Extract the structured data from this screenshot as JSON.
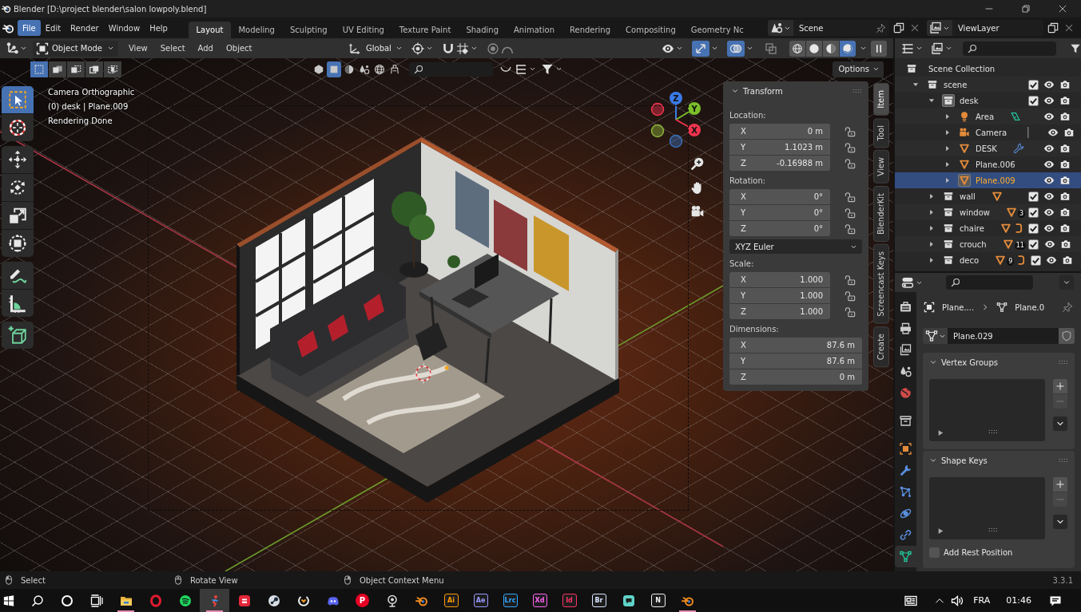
{
  "window": {
    "title": "Blender [D:\\project blender\\salon lowpoly.blend]"
  },
  "top_bar": {
    "menus": [
      {
        "label": "File",
        "selected": true
      },
      {
        "label": "Edit",
        "selected": false
      },
      {
        "label": "Render",
        "selected": false
      },
      {
        "label": "Window",
        "selected": false
      },
      {
        "label": "Help",
        "selected": false
      }
    ],
    "workspaces": [
      {
        "label": "Layout",
        "selected": true
      },
      {
        "label": "Modeling",
        "selected": false
      },
      {
        "label": "Sculpting",
        "selected": false
      },
      {
        "label": "UV Editing",
        "selected": false
      },
      {
        "label": "Texture Paint",
        "selected": false
      },
      {
        "label": "Shading",
        "selected": false
      },
      {
        "label": "Animation",
        "selected": false
      },
      {
        "label": "Rendering",
        "selected": false
      },
      {
        "label": "Compositing",
        "selected": false
      },
      {
        "label": "Geometry Nc",
        "selected": false
      }
    ],
    "scene": "Scene",
    "view_layer": "ViewLayer"
  },
  "viewport_header": {
    "mode": "Object Mode",
    "menus": [
      "View",
      "Select",
      "Add",
      "Object"
    ],
    "orientation": "Global",
    "toggles": [
      {
        "kind": "gizmo",
        "on": true
      },
      {
        "kind": "overlay",
        "on": true
      },
      {
        "kind": "xray",
        "on": false
      }
    ],
    "shading_modes": [
      {
        "kind": "wireframe",
        "selected": false
      },
      {
        "kind": "solid",
        "selected": false
      },
      {
        "kind": "material",
        "selected": false
      },
      {
        "kind": "rendered",
        "selected": true
      }
    ]
  },
  "tool_header": {
    "select_modes": [
      {
        "kind": "set",
        "selected": true
      },
      {
        "kind": "extend",
        "selected": false
      },
      {
        "kind": "subtract",
        "selected": false
      },
      {
        "kind": "invert",
        "selected": false
      },
      {
        "kind": "intersect",
        "selected": false
      }
    ],
    "object_types": [
      {
        "kind": "hexagon",
        "selected": false
      },
      {
        "kind": "square",
        "selected": true
      },
      {
        "kind": "half-circle",
        "selected": false
      },
      {
        "kind": "drops",
        "selected": false
      },
      {
        "kind": "globe",
        "selected": false
      },
      {
        "kind": "stool",
        "selected": false
      }
    ],
    "options": "Options"
  },
  "viewport": {
    "overlay_text": [
      "Camera Orthographic",
      "(0) desk | Plane.009",
      "Rendering Done"
    ],
    "tool_groups": [
      {
        "tools": [
          {
            "kind": "select-box",
            "selected": true
          },
          {
            "kind": "cursor",
            "selected": false
          }
        ]
      },
      {
        "tools": [
          {
            "kind": "move",
            "selected": false
          },
          {
            "kind": "rotate",
            "selected": false
          },
          {
            "kind": "scale",
            "selected": false
          },
          {
            "kind": "transform",
            "selected": false
          }
        ]
      },
      {
        "tools": [
          {
            "kind": "annotate",
            "selected": false
          },
          {
            "kind": "measure",
            "selected": false
          }
        ]
      },
      {
        "tools": [
          {
            "kind": "add-cube",
            "selected": false
          }
        ]
      }
    ],
    "gizmo": {
      "axes": [
        {
          "kind": "positive",
          "label": "Z",
          "color": "#3a7be8"
        },
        {
          "kind": "positive",
          "label": "Y",
          "color": "#7bbf2a"
        },
        {
          "kind": "positive",
          "label": "X",
          "color": "#f0344e"
        },
        {
          "kind": "negative",
          "color": "#f0344e"
        },
        {
          "kind": "negative",
          "color": "#8db33a"
        },
        {
          "kind": "negative",
          "color": "#3a6fb8"
        }
      ]
    }
  },
  "sidebar": {
    "panel": {
      "title": "Transform",
      "expanded": true,
      "groups": [
        {
          "kind": "vector",
          "label": "Location:",
          "rows": [
            {
              "axis": "X",
              "value": "0 m",
              "locked": false
            },
            {
              "axis": "Y",
              "value": "1.1023 m",
              "locked": false
            },
            {
              "axis": "Z",
              "value": "-0.16988 m",
              "locked": false
            }
          ]
        },
        {
          "kind": "vector",
          "label": "Rotation:",
          "rows": [
            {
              "axis": "X",
              "value": "0°",
              "locked": false
            },
            {
              "axis": "Y",
              "value": "0°",
              "locked": false
            },
            {
              "axis": "Z",
              "value": "0°",
              "locked": false
            }
          ]
        },
        {
          "kind": "dropdown",
          "value": "XYZ Euler"
        },
        {
          "kind": "vector",
          "label": "Scale:",
          "rows": [
            {
              "axis": "X",
              "value": "1.000",
              "locked": false
            },
            {
              "axis": "Y",
              "value": "1.000",
              "locked": false
            },
            {
              "axis": "Z",
              "value": "1.000",
              "locked": false
            }
          ]
        },
        {
          "kind": "vector",
          "label": "Dimensions:",
          "rows": [
            {
              "axis": "X",
              "value": "87.6 m"
            },
            {
              "axis": "Y",
              "value": "87.6 m"
            },
            {
              "axis": "Z",
              "value": "0 m"
            }
          ]
        }
      ]
    },
    "tabs": [
      {
        "label": "Item",
        "selected": true
      },
      {
        "label": "Tool",
        "selected": false
      },
      {
        "label": "View",
        "selected": false
      },
      {
        "label": "BlenderKit",
        "selected": false
      },
      {
        "label": "Screencast Keys",
        "selected": false
      },
      {
        "label": "Create",
        "selected": false
      }
    ]
  },
  "outliner": {
    "root": "Scene Collection",
    "items": [
      {
        "name": "scene",
        "kind": "collection",
        "expanded": true,
        "selected": false,
        "active": false,
        "checked": true,
        "children": [
          {
            "name": "desk",
            "kind": "collection",
            "expanded": true,
            "selected": false,
            "active": true,
            "checked": true,
            "children": [
              {
                "name": "Area",
                "kind": "light",
                "expanded": false,
                "selected": false,
                "active": false,
                "extras": [
                  {
                    "kind": "light-data"
                  }
                ]
              },
              {
                "name": "Camera",
                "kind": "camera",
                "expanded": false,
                "selected": false,
                "active": false,
                "extras": [
                  {
                    "kind": "camera-data"
                  }
                ]
              },
              {
                "name": "DESK",
                "kind": "mesh",
                "expanded": false,
                "selected": false,
                "active": false,
                "extras": [
                  {
                    "kind": "modifier"
                  }
                ]
              },
              {
                "name": "Plane.006",
                "kind": "mesh",
                "expanded": false,
                "selected": false,
                "active": false
              },
              {
                "name": "Plane.009",
                "kind": "mesh",
                "expanded": false,
                "selected": true,
                "active": true
              }
            ]
          },
          {
            "name": "wall",
            "kind": "collection",
            "expanded": false,
            "selected": false,
            "active": false,
            "checked": true,
            "extras": [
              {
                "kind": "mesh"
              }
            ]
          },
          {
            "name": "window",
            "kind": "collection",
            "expanded": false,
            "selected": false,
            "active": false,
            "checked": true,
            "extras": [
              {
                "kind": "mesh",
                "count": "3"
              }
            ]
          },
          {
            "name": "chaire",
            "kind": "collection",
            "expanded": false,
            "selected": false,
            "active": false,
            "checked": true,
            "extras": [
              {
                "kind": "mesh"
              },
              {
                "kind": "clipped"
              }
            ]
          },
          {
            "name": "crouch",
            "kind": "collection",
            "expanded": false,
            "selected": false,
            "active": false,
            "checked": true,
            "extras": [
              {
                "kind": "mesh",
                "count": "11"
              }
            ]
          },
          {
            "name": "deco",
            "kind": "collection",
            "expanded": false,
            "selected": false,
            "active": false,
            "checked": true,
            "extras": [
              {
                "kind": "mesh",
                "count": "9"
              },
              {
                "kind": "clipped"
              }
            ]
          }
        ]
      }
    ]
  },
  "properties": {
    "tab_groups": [
      {
        "tabs": [
          {
            "kind": "tool",
            "selected": false
          },
          {
            "kind": "output",
            "selected": false
          },
          {
            "kind": "view-layer",
            "selected": false
          },
          {
            "kind": "scene",
            "selected": false
          },
          {
            "kind": "world",
            "selected": false
          }
        ]
      },
      {
        "tabs": [
          {
            "kind": "collection",
            "selected": false
          }
        ]
      },
      {
        "tabs": [
          {
            "kind": "object",
            "selected": false
          },
          {
            "kind": "modifiers",
            "selected": false
          },
          {
            "kind": "particles",
            "selected": false
          },
          {
            "kind": "physics",
            "selected": false
          },
          {
            "kind": "constraints",
            "selected": false
          },
          {
            "kind": "data",
            "selected": true
          }
        ]
      }
    ],
    "breadcrumb": [
      {
        "kind": "object",
        "label": "Plane...."
      },
      {
        "kind": "mesh",
        "label": "Plane.0"
      }
    ],
    "data_block": "Plane.029",
    "panels": [
      {
        "title": "Vertex Groups",
        "expanded": true
      },
      {
        "title": "Shape Keys",
        "expanded": true,
        "option": {
          "label": "Add Rest Position",
          "checked": false
        }
      }
    ]
  },
  "status_bar": {
    "hints": [
      {
        "kind": "left",
        "label": "Select"
      },
      {
        "kind": "middle",
        "label": "Rotate View"
      },
      {
        "kind": "right",
        "label": "Object Context Menu"
      }
    ],
    "version": "3.3.1"
  },
  "taskbar": {
    "apps": [
      {
        "kind": "folder",
        "open": true,
        "selected": false
      },
      {
        "kind": "ring",
        "open": false,
        "selected": false
      },
      {
        "kind": "wave-disc",
        "open": false,
        "selected": false
      },
      {
        "kind": "figure",
        "open": true,
        "selected": true
      },
      {
        "kind": "fist-tile",
        "open": false,
        "selected": false
      },
      {
        "kind": "piston-disc",
        "open": false,
        "selected": false
      },
      {
        "kind": "split-ring",
        "open": false,
        "selected": false
      },
      {
        "kind": "gamepad",
        "open": false,
        "selected": false
      },
      {
        "kind": "letter-disc",
        "label": "P",
        "color": "#e60023",
        "open": false,
        "selected": false
      },
      {
        "kind": "webcam",
        "open": false,
        "selected": false
      },
      {
        "kind": "blender",
        "open": false,
        "selected": false
      },
      {
        "kind": "letter-tile",
        "label": "Ai",
        "color": "#ff9a00",
        "open": false,
        "selected": false
      },
      {
        "kind": "letter-tile",
        "label": "Ae",
        "color": "#9999ff",
        "open": false,
        "selected": false
      },
      {
        "kind": "letter-tile",
        "label": "Lrc",
        "color": "#31a8ff",
        "open": false,
        "selected": false
      },
      {
        "kind": "letter-tile",
        "label": "Xd",
        "color": "#ff61f6",
        "open": false,
        "selected": false
      },
      {
        "kind": "letter-tile",
        "label": "Id",
        "color": "#ff3366",
        "open": false,
        "selected": false
      },
      {
        "kind": "letter-tile",
        "label": "Br",
        "color": "#d8e4ff",
        "open": false,
        "selected": false
      },
      {
        "kind": "chat-tile",
        "open": false,
        "selected": false
      },
      {
        "kind": "letter-tile",
        "label": "N",
        "color": "#f0f0f0",
        "open": false,
        "selected": false
      },
      {
        "kind": "blender",
        "open": true,
        "selected": false
      }
    ],
    "tray": {
      "language": "FRA",
      "time": "01:46"
    }
  }
}
